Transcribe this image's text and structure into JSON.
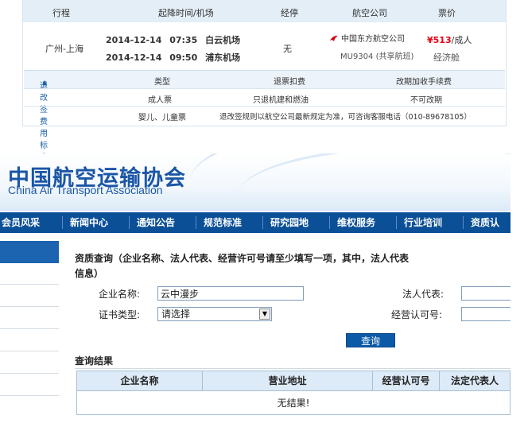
{
  "flight": {
    "headers": {
      "route": "行程",
      "time": "起降时间/机场",
      "stops": "经停",
      "airline": "航空公司",
      "price": "票价"
    },
    "route": "广州-上海",
    "depart": {
      "date": "2014-12-14",
      "time": "07:35",
      "airport": "白云机场"
    },
    "arrive": {
      "date": "2014-12-14",
      "time": "09:50",
      "airport": "浦东机场"
    },
    "stops": "无",
    "airline_name": "中国东方航空公司",
    "flight_no": "MU9304 (共享航班)",
    "price_amount": "¥513",
    "price_unit": "/成人",
    "cabin": "经济舱",
    "refund": {
      "toggle_label": "退改签费用标准",
      "col_type": "类型",
      "col_refund": "退票扣费",
      "col_change": "改期加收手续费",
      "adult_label": "成人票",
      "adult_refund": "只退机建和燃油",
      "adult_change": "不可改期",
      "child_label": "婴儿、儿童票",
      "child_note": "退改签规则以航空公司最新规定为准，可咨询客服电话（010-89678105）"
    },
    "colors": {
      "price": "#e60012",
      "header_bg": "#e3eef7"
    }
  },
  "site": {
    "logo_cn": "中国航空运输协会",
    "logo_en": "China Air Transport Association",
    "nav": [
      "会员风采",
      "新闻中心",
      "通知公告",
      "规范标准",
      "研究园地",
      "维权服务",
      "行业培训",
      "资质认"
    ],
    "query_title": "资质查询（企业名称、法人代表、经营许可号请至少填写一项，其中，法人代表",
    "query_title2": "信息）",
    "company_label": "企业名称:",
    "company_value": "云中漫步",
    "legal_label": "法人代表:",
    "legal_value": "",
    "cert_label": "证书类型:",
    "cert_selected": "请选择",
    "license_label": "经营认可号:",
    "license_value": "",
    "query_button": "查询",
    "results_title": "查询结果",
    "columns": [
      "企业名称",
      "营业地址",
      "经营认可号",
      "法定代表人"
    ],
    "no_result": "无结果!",
    "colors": {
      "nav_bg": "#0b4f97",
      "logo": "#1a56a6"
    }
  }
}
